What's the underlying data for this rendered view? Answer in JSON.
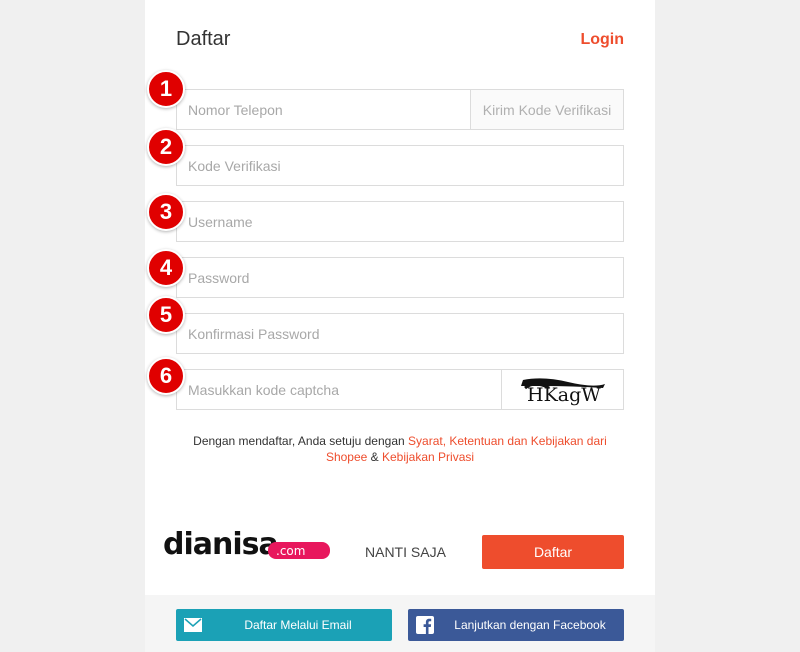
{
  "header": {
    "title": "Daftar",
    "login_label": "Login"
  },
  "form": {
    "phone": {
      "placeholder": "Nomor Telepon",
      "value": ""
    },
    "send_code_label": "Kirim Kode Verifikasi",
    "code": {
      "placeholder": "Kode Verifikasi",
      "value": ""
    },
    "username": {
      "placeholder": "Username",
      "value": ""
    },
    "password": {
      "placeholder": "Password",
      "value": ""
    },
    "confirm_password": {
      "placeholder": "Konfirmasi Password",
      "value": ""
    },
    "captcha": {
      "placeholder": "Masukkan kode captcha",
      "value": "",
      "image_text": "HKagW"
    }
  },
  "badges": [
    "1",
    "2",
    "3",
    "4",
    "5",
    "6"
  ],
  "terms": {
    "prefix": "Dengan mendaftar, Anda setuju dengan ",
    "link1": "Syarat, Ketentuan dan Kebijakan dari Shopee",
    "and": " & ",
    "link2": "Kebijakan Privasi"
  },
  "watermark": {
    "main": "dianisa",
    "suffix": ".com"
  },
  "actions": {
    "later_label": "NANTI SAJA",
    "submit_label": "Daftar"
  },
  "social": {
    "email_label": "Daftar Melalui Email",
    "facebook_label": "Lanjutkan dengan Facebook"
  },
  "colors": {
    "accent": "#ee4d2d",
    "badge": "#e00000",
    "email": "#1ba1b6",
    "facebook": "#3b5998"
  }
}
